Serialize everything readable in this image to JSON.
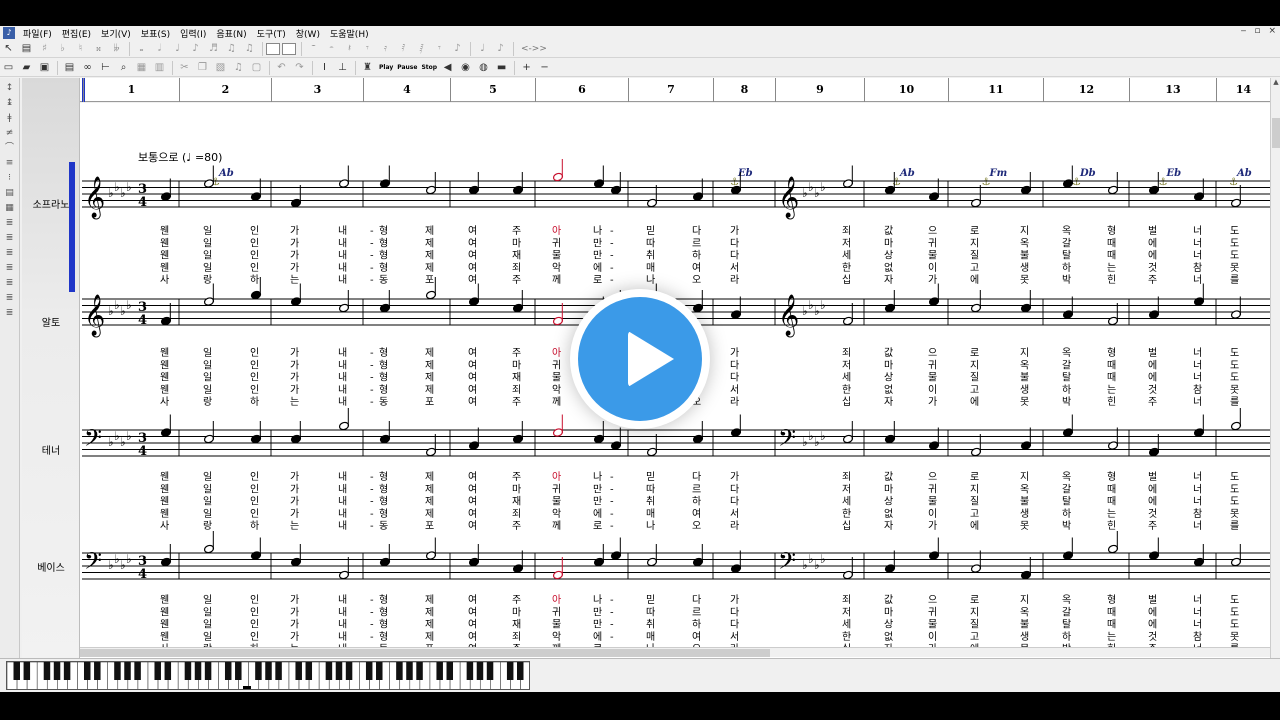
{
  "menu": [
    "파일(F)",
    "편집(E)",
    "보기(V)",
    "보표(S)",
    "입력(I)",
    "음표(N)",
    "도구(T)",
    "창(W)",
    "도움말(H)"
  ],
  "window_controls": [
    "‒",
    "▫",
    "×"
  ],
  "toolbar_text": {
    "play": "Play",
    "pause": "Pause",
    "stop": "Stop"
  },
  "tempo_arrows": "<->>",
  "measures": [
    "1",
    "2",
    "3",
    "4",
    "5",
    "6",
    "7",
    "8",
    "9",
    "10",
    "11",
    "12",
    "13",
    "14"
  ],
  "tempo_marking": "보통으로 (♩ =80)",
  "chords": [
    {
      "label": "Ab",
      "measure": 2
    },
    {
      "label": "Eb",
      "measure": 8
    },
    {
      "label": "Ab",
      "measure": 10
    },
    {
      "label": "Fm",
      "measure": 11
    },
    {
      "label": "Db",
      "measure": 12
    },
    {
      "label": "Eb",
      "measure": 13
    },
    {
      "label": "Ab",
      "measure": 14
    }
  ],
  "time_signature": {
    "top": "3",
    "bottom": "4"
  },
  "tracks": [
    {
      "name": "소프라노",
      "clef": "treble"
    },
    {
      "name": "알토",
      "clef": "treble"
    },
    {
      "name": "테너",
      "clef": "bass"
    },
    {
      "name": "베이스",
      "clef": "bass"
    }
  ],
  "lyrics": [
    [
      "웬",
      "일",
      "인",
      "가",
      "내",
      "-",
      "형",
      "제",
      "여",
      "주",
      "아",
      "나",
      "-",
      "믿",
      "다",
      "가",
      "죄",
      "값",
      "으",
      "로",
      "지",
      "옥",
      "형",
      "벌",
      "너",
      "도"
    ],
    [
      "웬",
      "일",
      "인",
      "가",
      "내",
      "-",
      "형",
      "제",
      "여",
      "마",
      "귀",
      "만",
      "-",
      "따",
      "르",
      "다",
      "저",
      "마",
      "귀",
      "지",
      "옥",
      "갈",
      "때",
      "에",
      "너",
      "도"
    ],
    [
      "웬",
      "일",
      "인",
      "가",
      "내",
      "-",
      "형",
      "제",
      "여",
      "재",
      "물",
      "만",
      "-",
      "취",
      "하",
      "다",
      "세",
      "상",
      "물",
      "질",
      "불",
      "탈",
      "때",
      "에",
      "너",
      "도"
    ],
    [
      "웬",
      "일",
      "인",
      "가",
      "내",
      "-",
      "형",
      "제",
      "여",
      "죄",
      "악",
      "에",
      "-",
      "매",
      "여",
      "서",
      "한",
      "없",
      "이",
      "고",
      "생",
      "하",
      "는",
      "것",
      "참",
      "못"
    ],
    [
      "사",
      "랑",
      "하",
      "는",
      "내",
      "-",
      "동",
      "포",
      "여",
      "주",
      "께",
      "로",
      "-",
      "나",
      "오",
      "라",
      "십",
      "자",
      "가",
      "에",
      "못",
      "박",
      "힌",
      "주",
      "너",
      "를"
    ]
  ],
  "highlight_color": "#c8102e",
  "accent_color": "#1f36c8",
  "play_button": "play-icon"
}
